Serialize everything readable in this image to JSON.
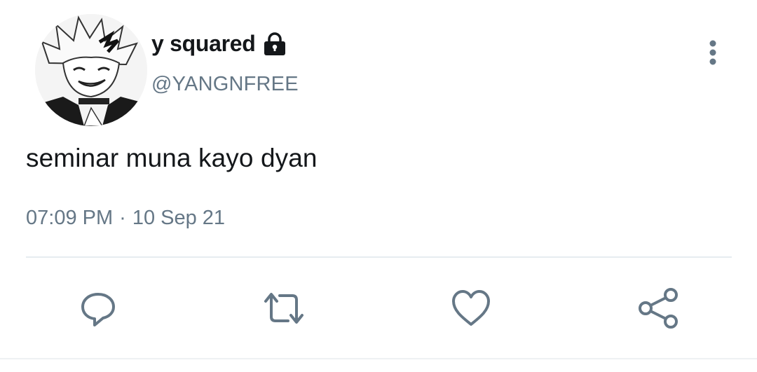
{
  "tweet": {
    "author": {
      "display_name": "y squared",
      "handle": "@YANGNFREE",
      "avatar_icon": "anime-character-avatar",
      "protected_icon": "lock-icon"
    },
    "text": "seminar muna kayo dyan",
    "time": "07:09 PM",
    "separator": "·",
    "date": "10 Sep 21"
  },
  "actions": [
    {
      "name": "reply",
      "icon": "speech-bubble-icon"
    },
    {
      "name": "retweet",
      "icon": "retweet-arrows-icon"
    },
    {
      "name": "like",
      "icon": "heart-icon"
    },
    {
      "name": "share",
      "icon": "share-nodes-icon"
    }
  ],
  "menu": {
    "icon": "vertical-ellipsis-icon"
  },
  "colors": {
    "primary_text": "#14171a",
    "secondary_text": "#657786",
    "divider": "#e6ecf0"
  }
}
